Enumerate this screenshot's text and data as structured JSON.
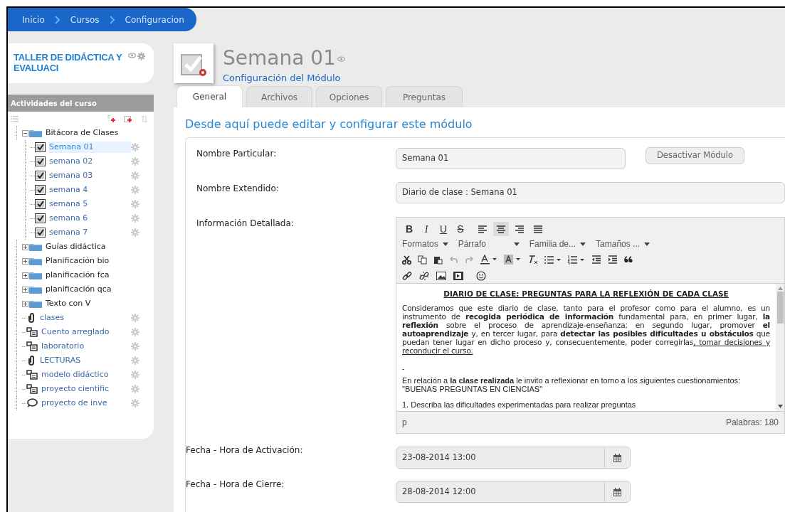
{
  "breadcrumb": [
    {
      "label": "Inicio"
    },
    {
      "label": "Cursos"
    },
    {
      "label": "Configuracion"
    }
  ],
  "course": {
    "title": "TALLER DE DIDÁCTICA Y EVALUACI"
  },
  "sidebar": {
    "title": "Actividades del curso",
    "tree": [
      {
        "kind": "folder",
        "label": "Bitácora de Clases",
        "expanded": true,
        "selected": false,
        "children": [
          {
            "kind": "check",
            "label": "Semana 01",
            "selected": true
          },
          {
            "kind": "check",
            "label": "semana 02",
            "selected": false
          },
          {
            "kind": "check",
            "label": "semana 03",
            "selected": false
          },
          {
            "kind": "check",
            "label": "semana 4",
            "selected": false
          },
          {
            "kind": "check",
            "label": "semana 5",
            "selected": false
          },
          {
            "kind": "check",
            "label": "semana 6",
            "selected": false
          },
          {
            "kind": "check",
            "label": "semana 7",
            "selected": false
          }
        ]
      },
      {
        "kind": "folder",
        "label": "Guías didáctica",
        "expanded": false,
        "selected": false
      },
      {
        "kind": "folder",
        "label": "Planificación bio",
        "expanded": false,
        "selected": false
      },
      {
        "kind": "folder",
        "label": "planificación fca",
        "expanded": false,
        "selected": false
      },
      {
        "kind": "folder",
        "label": "planificación qca",
        "expanded": false,
        "selected": false
      },
      {
        "kind": "folder",
        "label": "Texto con V",
        "expanded": false,
        "selected": false
      },
      {
        "kind": "attachment",
        "label": "clases",
        "selected": false
      },
      {
        "kind": "page",
        "label": "Cuento arreglado",
        "selected": false
      },
      {
        "kind": "page",
        "label": "laboratorio",
        "selected": false
      },
      {
        "kind": "attachment",
        "label": "LECTURAS",
        "selected": false
      },
      {
        "kind": "page",
        "label": "modelo didáctico",
        "selected": false
      },
      {
        "kind": "page",
        "label": "proyecto cientific",
        "selected": false
      },
      {
        "kind": "forum",
        "label": "proyecto de inve",
        "selected": false
      }
    ]
  },
  "module": {
    "title": "Semana 01",
    "subtitle": "Configuración del Módulo"
  },
  "tabs": [
    {
      "label": "General",
      "selected": true
    },
    {
      "label": "Archivos",
      "selected": false
    },
    {
      "label": "Opciones",
      "selected": false
    },
    {
      "label": "Preguntas",
      "selected": false
    }
  ],
  "heading": "Desde aquí puede editar y configurar este módulo",
  "form": {
    "name": {
      "label": "Nombre Particular:",
      "value": "Semana 01"
    },
    "deactivate_button": "Desactivar Módulo",
    "extended_name": {
      "label": "Nombre Extendido:",
      "value": "Diario de clase : Semana 01"
    },
    "details": {
      "label": "Información Detallada:"
    },
    "activation": {
      "label": "Fecha - Hora de Activación:",
      "value": "23-08-2014 13:00"
    },
    "closing": {
      "label": "Fecha - Hora de Cierre:",
      "value": "28-08-2014 12:00"
    }
  },
  "editor": {
    "format_buttons": [
      {
        "label": "B"
      },
      {
        "label": "I"
      },
      {
        "label": "U"
      },
      {
        "label": "S"
      }
    ],
    "align_buttons": [
      {
        "selected": false
      },
      {
        "selected": true
      },
      {
        "selected": false
      },
      {
        "selected": false
      }
    ],
    "dropdowns": [
      {
        "label": "Formatos"
      },
      {
        "label": "Párrafo"
      },
      {
        "label": "Familia de..."
      },
      {
        "label": "Tamaños ..."
      }
    ],
    "content_title": "DIARIO DE CLASE: PREGUNTAS PARA LA REFLEXIÓN DE CADA CLASE",
    "paragraph": "Consideramos que este diario de clase, tanto para el profesor como para el alumno, es un instrumento de **recogida periódica de información** fundamental para, en primer lugar, **la reflexión** sobre el proceso de aprendizaje-enseñanza; en segundo lugar, promover **el autoaprendizaje** y, en tercer lugar, para **detectar las posibles dificultades u obstáculos** que puedan tener lugar en dicho proceso y, consecuentemente, poder corregirlas",
    "paragraph_underlined": ", tomar decisiones y reconducir el curso.",
    "dash": "-",
    "intro": "En relación a **la clase realizada** le invito a reflexionar en torno a los siguientes cuestionamientos: \"BUENAS PREGUNTAS EN CIENCIAS\"",
    "question": "1. Describa las dificultades experimentadas para realizar preguntas",
    "path": "p",
    "word_count": "Palabras: 180"
  }
}
